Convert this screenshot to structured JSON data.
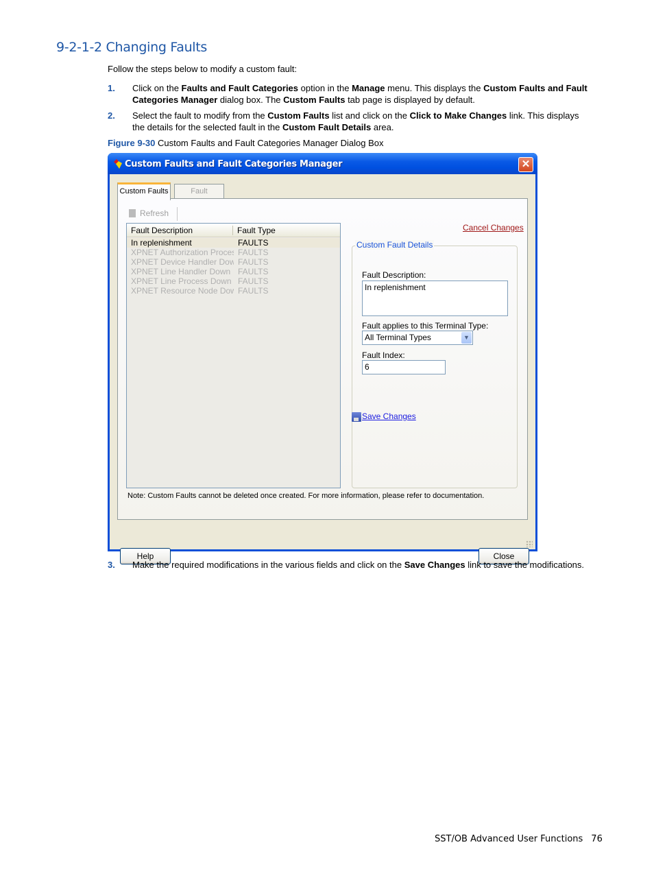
{
  "document": {
    "heading": "9-2-1-2  Changing Faults",
    "intro": "Follow the steps below to modify a custom fault:",
    "steps": [
      {
        "num": "1.",
        "html": "Click on the <b>Faults and Fault Categories</b> option in the <b>Manage</b> menu.  This displays the <b>Custom Faults and Fault Categories Manager</b> dialog box.  The <b>Custom Faults</b> tab page is displayed by default."
      },
      {
        "num": "2.",
        "html": "Select the fault to modify from the <b>Custom Faults</b> list and click on the <b>Click to Make Changes</b> link.  This displays the details for the selected fault in the <b>Custom Fault Details</b> area."
      },
      {
        "num": "3.",
        "html": "Make the required modifications in the various fields and click on the <b>Save Changes</b> link to save the modifications."
      }
    ],
    "figure_label": "Figure 9-30",
    "figure_caption": " Custom Faults and Fault Categories Manager Dialog Box",
    "footer_title": "SST/OB Advanced User Functions",
    "page_number": "76"
  },
  "dialog": {
    "title": "Custom Faults and Fault Categories Manager",
    "close_glyph": "✕",
    "tabs": [
      {
        "label": "Custom Faults",
        "active": true
      },
      {
        "label": "Fault Categories",
        "active": false
      }
    ],
    "refresh_label": "Refresh",
    "list": {
      "columns": [
        "Fault Description",
        "Fault Type"
      ],
      "rows": [
        {
          "description": "In replenishment",
          "type": "FAULTS",
          "selected": true
        },
        {
          "description": "XPNET Authorization Proces...",
          "type": "FAULTS",
          "selected": false
        },
        {
          "description": "XPNET Device Handler Down",
          "type": "FAULTS",
          "selected": false
        },
        {
          "description": "XPNET Line Handler Down",
          "type": "FAULTS",
          "selected": false
        },
        {
          "description": "XPNET Line Process Down",
          "type": "FAULTS",
          "selected": false
        },
        {
          "description": "XPNET Resource Node Down",
          "type": "FAULTS",
          "selected": false
        }
      ]
    },
    "cancel_changes": "Cancel Changes",
    "details": {
      "group_title": "Custom Fault Details",
      "description_label": "Fault Description:",
      "description_value": "In replenishment",
      "terminal_label": "Fault applies to this Terminal Type:",
      "terminal_value": "All Terminal Types",
      "index_label": "Fault Index:",
      "index_value": "6",
      "save_changes": "Save Changes"
    },
    "note": "Note: Custom Faults cannot be deleted once created. For more information, please refer to documentation.",
    "help_button": "Help",
    "close_button": "Close"
  }
}
